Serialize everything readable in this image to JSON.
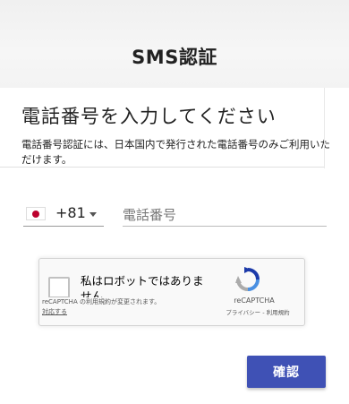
{
  "header": {
    "title": "SMS認証"
  },
  "card": {
    "title": "電話番号を入力してください",
    "description": "電話番号認証には、日本国内で発行された電話番号のみご利用いただけます。"
  },
  "phone_form": {
    "country_code": "+81",
    "flag_icon": "japan-flag-icon",
    "phone_placeholder": "電話番号",
    "phone_value": ""
  },
  "recaptcha": {
    "checkbox_label": "私はロボットではありません",
    "notice": "reCAPTCHA の利用規約が変更されます。",
    "notice_link": "対応する",
    "brand": "reCAPTCHA",
    "terms": "プライバシー - 利用規約",
    "checked": false
  },
  "actions": {
    "submit_label": "確認",
    "accent": "#3f51b5"
  }
}
